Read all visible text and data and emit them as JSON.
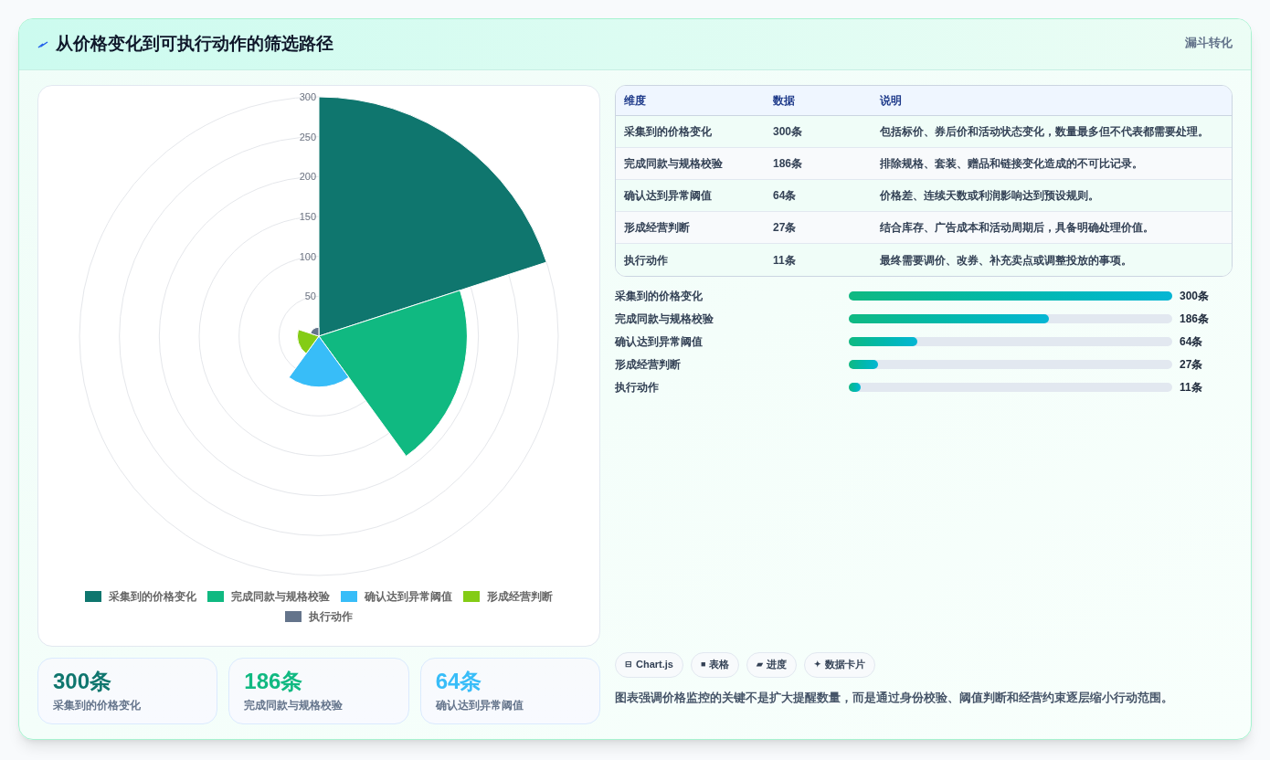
{
  "header": {
    "title": "从价格变化到可执行动作的筛选路径",
    "badge": "漏斗转化"
  },
  "chart": {
    "ticks": [
      "300",
      "250",
      "200",
      "150",
      "100",
      "50"
    ],
    "sectors": [
      {
        "label": "采集到的价格变化",
        "color": "#0f766e"
      },
      {
        "label": "完成同款与规格校验",
        "color": "#10b981"
      },
      {
        "label": "确认达到异常阈值",
        "color": "#38bdf8"
      },
      {
        "label": "形成经营判断",
        "color": "#84cc16"
      },
      {
        "label": "执行动作",
        "color": "#64748b"
      }
    ]
  },
  "stats": [
    {
      "value": "300条",
      "label": "采集到的价格变化",
      "color": "#0f766e"
    },
    {
      "value": "186条",
      "label": "完成同款与规格校验",
      "color": "#10b981"
    },
    {
      "value": "64条",
      "label": "确认达到异常阈值",
      "color": "#38bdf8"
    }
  ],
  "table": {
    "columns": [
      "维度",
      "数据",
      "说明"
    ],
    "rows": [
      [
        "采集到的价格变化",
        "300条",
        "包括标价、券后价和活动状态变化，数量最多但不代表都需要处理。"
      ],
      [
        "完成同款与规格校验",
        "186条",
        "排除规格、套装、赠品和链接变化造成的不可比记录。"
      ],
      [
        "确认达到异常阈值",
        "64条",
        "价格差、连续天数或利润影响达到预设规则。"
      ],
      [
        "形成经营判断",
        "27条",
        "结合库存、广告成本和活动周期后，具备明确处理价值。"
      ],
      [
        "执行动作",
        "11条",
        "最终需要调价、改券、补充卖点或调整投放的事项。"
      ]
    ]
  },
  "progress": [
    {
      "label": "采集到的价格变化",
      "level": 1,
      "reading": "300条"
    },
    {
      "label": "完成同款与规格校验",
      "level": 0.62,
      "reading": "186条"
    },
    {
      "label": "确认达到异常阈值",
      "level": 0.213,
      "reading": "64条"
    },
    {
      "label": "形成经营判断",
      "level": 0.09,
      "reading": "27条"
    },
    {
      "label": "执行动作",
      "level": 0.037,
      "reading": "11条"
    }
  ],
  "chips": [
    {
      "icon": "⊟",
      "label": "Chart.js"
    },
    {
      "icon": "■",
      "label": "表格"
    },
    {
      "icon": "▰",
      "label": "进度"
    },
    {
      "icon": "✦",
      "label": "数据卡片"
    }
  ],
  "note": "图表强调价格监控的关键不是扩大提醒数量，而是通过身份校验、阈值判断和经营约束逐层缩小行动范围。"
}
